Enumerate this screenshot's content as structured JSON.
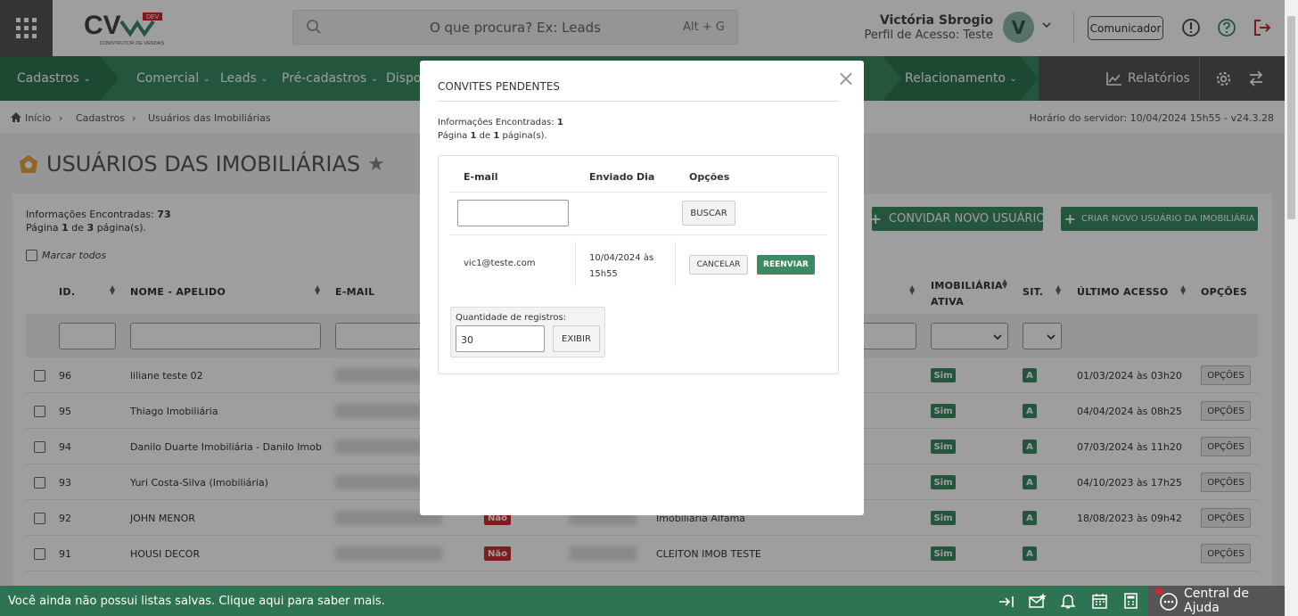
{
  "header": {
    "logo_text": "CV",
    "logo_tag": "DEV",
    "logo_sub": "CONSTRUTOR DE VENDAS",
    "search_placeholder": "O que procura? Ex: Leads",
    "search_shortcut": "Alt + G",
    "user_name": "Victória Sbrogio",
    "user_role": "Perfil de Acesso: Teste",
    "avatar_letter": "V",
    "comunicador_label": "Comunicador"
  },
  "nav": {
    "items": [
      "Cadastros",
      "Comercial",
      "Leads",
      "Pré-cadastros",
      "Dispo",
      "Relacionamento"
    ],
    "relatorios": "Relatórios"
  },
  "breadcrumb": {
    "home": "Início",
    "level1": "Cadastros",
    "level2": "Usuários das Imobiliárias",
    "server_time": "Horário do servidor: 10/04/2024 15h55 - v24.3.28"
  },
  "page": {
    "title": "USUÁRIOS DAS IMOBILIÁRIAS",
    "info_label": "Informações Encontradas:",
    "info_count": "73",
    "page_pre": "Página",
    "page_cur": "1",
    "page_mid": "de",
    "page_total": "3",
    "page_post": "página(s).",
    "mark_all": "Marcar todos",
    "btn_invite": "CONVIDAR NOVO USUÁRIO",
    "btn_create": "CRIAR NOVO USUÁRIO DA IMOBILIÁRIA"
  },
  "table": {
    "headers": {
      "id": "ID.",
      "nome": "NOME - APELIDO",
      "email": "E-MAIL",
      "imob_ativa_1": "IMOBILIÁRIA",
      "imob_ativa_2": "ATIVA",
      "sit": "SIT.",
      "ultimo": "ÚLTIMO ACESSO",
      "opcoes": "OPÇÕES"
    },
    "rows": [
      {
        "id": "96",
        "nome": "liliane teste 02",
        "ativa": "Sim",
        "sit": "A",
        "acesso": "01/03/2024 às 03h20",
        "opt": "OPÇÕES"
      },
      {
        "id": "95",
        "nome": "Thiago Imobiliária",
        "ativa": "Sim",
        "sit": "A",
        "acesso": "04/04/2024 às 08h25",
        "opt": "OPÇÕES"
      },
      {
        "id": "94",
        "nome": "Danilo Duarte Imobiliária - Danilo Imob",
        "ativa": "Sim",
        "sit": "A",
        "acesso": "07/03/2024 às 11h20",
        "opt": "OPÇÕES"
      },
      {
        "id": "93",
        "nome": "Yuri Costa-Silva (Imobiliária)",
        "ativa": "Sim",
        "sit": "A",
        "acesso": "04/10/2023 às 17h25",
        "opt": "OPÇÕES"
      },
      {
        "id": "92",
        "nome": "JOHN MENOR",
        "nao": "Não",
        "imob": "Imobiliária Alfama",
        "ativa": "Sim",
        "sit": "A",
        "acesso": "18/08/2023 às 09h42",
        "opt": "OPÇÕES"
      },
      {
        "id": "91",
        "nome": "HOUSI DECOR",
        "nao": "Não",
        "imob": "CLEITON IMOB TESTE",
        "ativa": "Sim",
        "sit": "A",
        "acesso": "",
        "opt": "OPÇÕES"
      }
    ]
  },
  "modal": {
    "title": "CONVITES PENDENTES",
    "info_label": "Informações Encontradas:",
    "info_count": "1",
    "page_pre": "Página",
    "page_cur": "1",
    "page_mid": "de",
    "page_total": "1",
    "page_post": "página(s).",
    "col_email": "E-mail",
    "col_enviado": "Enviado Dia",
    "col_opcoes": "Opções",
    "btn_buscar": "BUSCAR",
    "row_email": "vic1@teste.com",
    "row_date_1": "10/04/2024 às",
    "row_date_2": "15h55",
    "btn_cancelar": "CANCELAR",
    "btn_reenviar": "REENVIAR",
    "qty_label": "Quantidade de registros:",
    "qty_value": "30",
    "btn_exibir": "EXIBIR"
  },
  "footer": {
    "message": "Você ainda não possui listas salvas. Clique aqui para saber mais.",
    "help": "Central de Ajuda"
  },
  "colors": {
    "primary_green": "#3b8a63",
    "dark_green": "#2f7452",
    "danger_red": "#c9302c",
    "logout_red": "#d9232d"
  }
}
